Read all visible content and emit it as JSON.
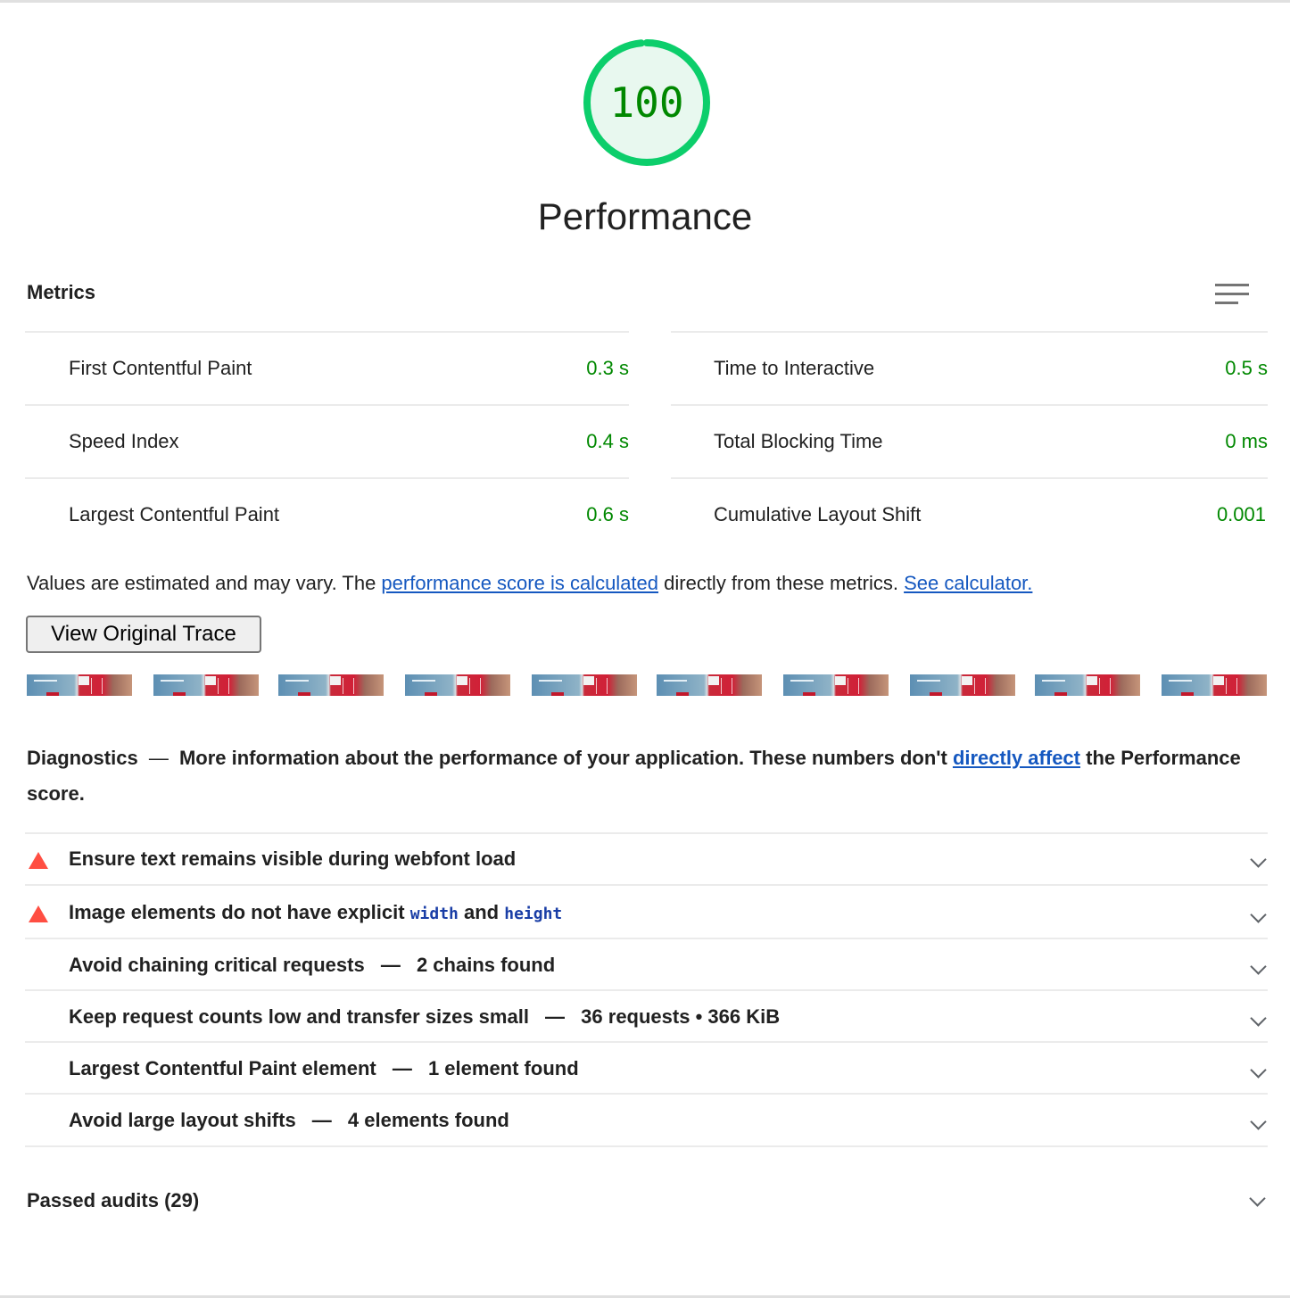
{
  "score": {
    "value": "100",
    "fraction": 1.0,
    "title": "Performance",
    "color": "#0cce6b"
  },
  "metrics": {
    "heading": "Metrics",
    "left": [
      {
        "label": "First Contentful Paint",
        "value": "0.3 s"
      },
      {
        "label": "Speed Index",
        "value": "0.4 s"
      },
      {
        "label": "Largest Contentful Paint",
        "value": "0.6 s"
      }
    ],
    "right": [
      {
        "label": "Time to Interactive",
        "value": "0.5 s"
      },
      {
        "label": "Total Blocking Time",
        "value": "0 ms"
      },
      {
        "label": "Cumulative Layout Shift",
        "value": "0.001"
      }
    ],
    "pass_color": "#008800"
  },
  "note": {
    "prefix": "Values are estimated and may vary. The ",
    "link1": "performance score is calculated",
    "middle": " directly from these metrics. ",
    "link2": "See calculator."
  },
  "trace_button": "View Original Trace",
  "filmstrip": {
    "frame_count": 10
  },
  "diagnostics": {
    "title": "Diagnostics",
    "dash": "—",
    "text1": "More information about the performance of your application. These numbers don't ",
    "link": "directly affect",
    "text2": " the Performance score."
  },
  "audits": [
    {
      "title": "Ensure text remains visible during webfont load",
      "detail": "",
      "warn": true
    },
    {
      "title": "Image elements do not have explicit",
      "code1": "width",
      "and": "and",
      "code2": "height",
      "warn": true
    },
    {
      "title": "Avoid chaining critical requests",
      "detail": "2 chains found",
      "warn": false
    },
    {
      "title": "Keep request counts low and transfer sizes small",
      "detail": "36 requests • 366 KiB",
      "warn": false
    },
    {
      "title": "Largest Contentful Paint element",
      "detail": "1 element found",
      "warn": false
    },
    {
      "title": "Avoid large layout shifts",
      "detail": "4 elements found",
      "warn": false
    }
  ],
  "passed": "Passed audits (29)"
}
